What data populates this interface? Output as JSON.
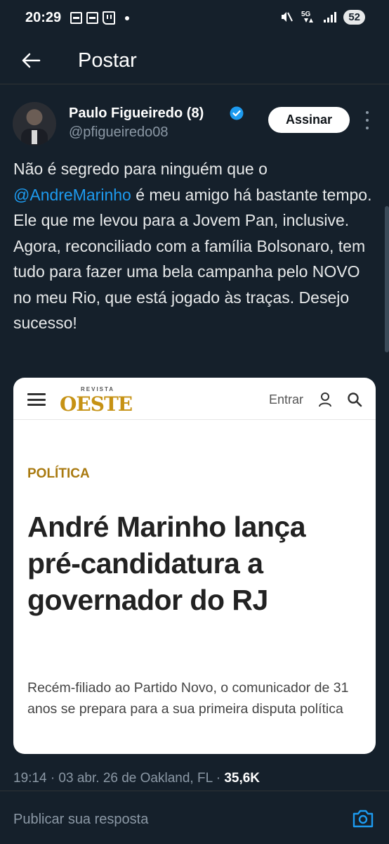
{
  "status_bar": {
    "time": "20:29",
    "network": "5G",
    "battery": "52"
  },
  "header": {
    "title": "Postar"
  },
  "author": {
    "name": "Paulo Figueiredo (8)",
    "handle": "@pfigueiredo08",
    "subscribe_label": "Assinar"
  },
  "tweet": {
    "text_before": "Não é segredo para ninguém que o ",
    "mention": "@AndreMarinho",
    "text_after": " é meu amigo há bastante tempo. Ele que me levou para a Jovem Pan, inclusive. Agora, reconciliado com a família Bolsonaro, tem tudo para fazer uma bela campanha pelo NOVO no meu Rio, que está jogado às traças. Desejo sucesso!"
  },
  "card": {
    "logo_small": "REVISTA",
    "logo_big": "OESTE",
    "login_label": "Entrar",
    "category": "POLÍTICA",
    "headline": "André Marinho lança pré-candidatura a governador do RJ",
    "subheadline": "Recém-filiado ao Partido Novo, o comunicador de 31 anos se prepara para a sua primeira disputa política"
  },
  "meta": {
    "timestamp": "19:14 · 03 abr. 26 de Oakland, FL · ",
    "views": "35,6K"
  },
  "reply": {
    "placeholder": "Publicar sua resposta"
  },
  "colors": {
    "background": "#15202b",
    "accent": "#1d9bf0",
    "card_brand": "#c69214"
  }
}
